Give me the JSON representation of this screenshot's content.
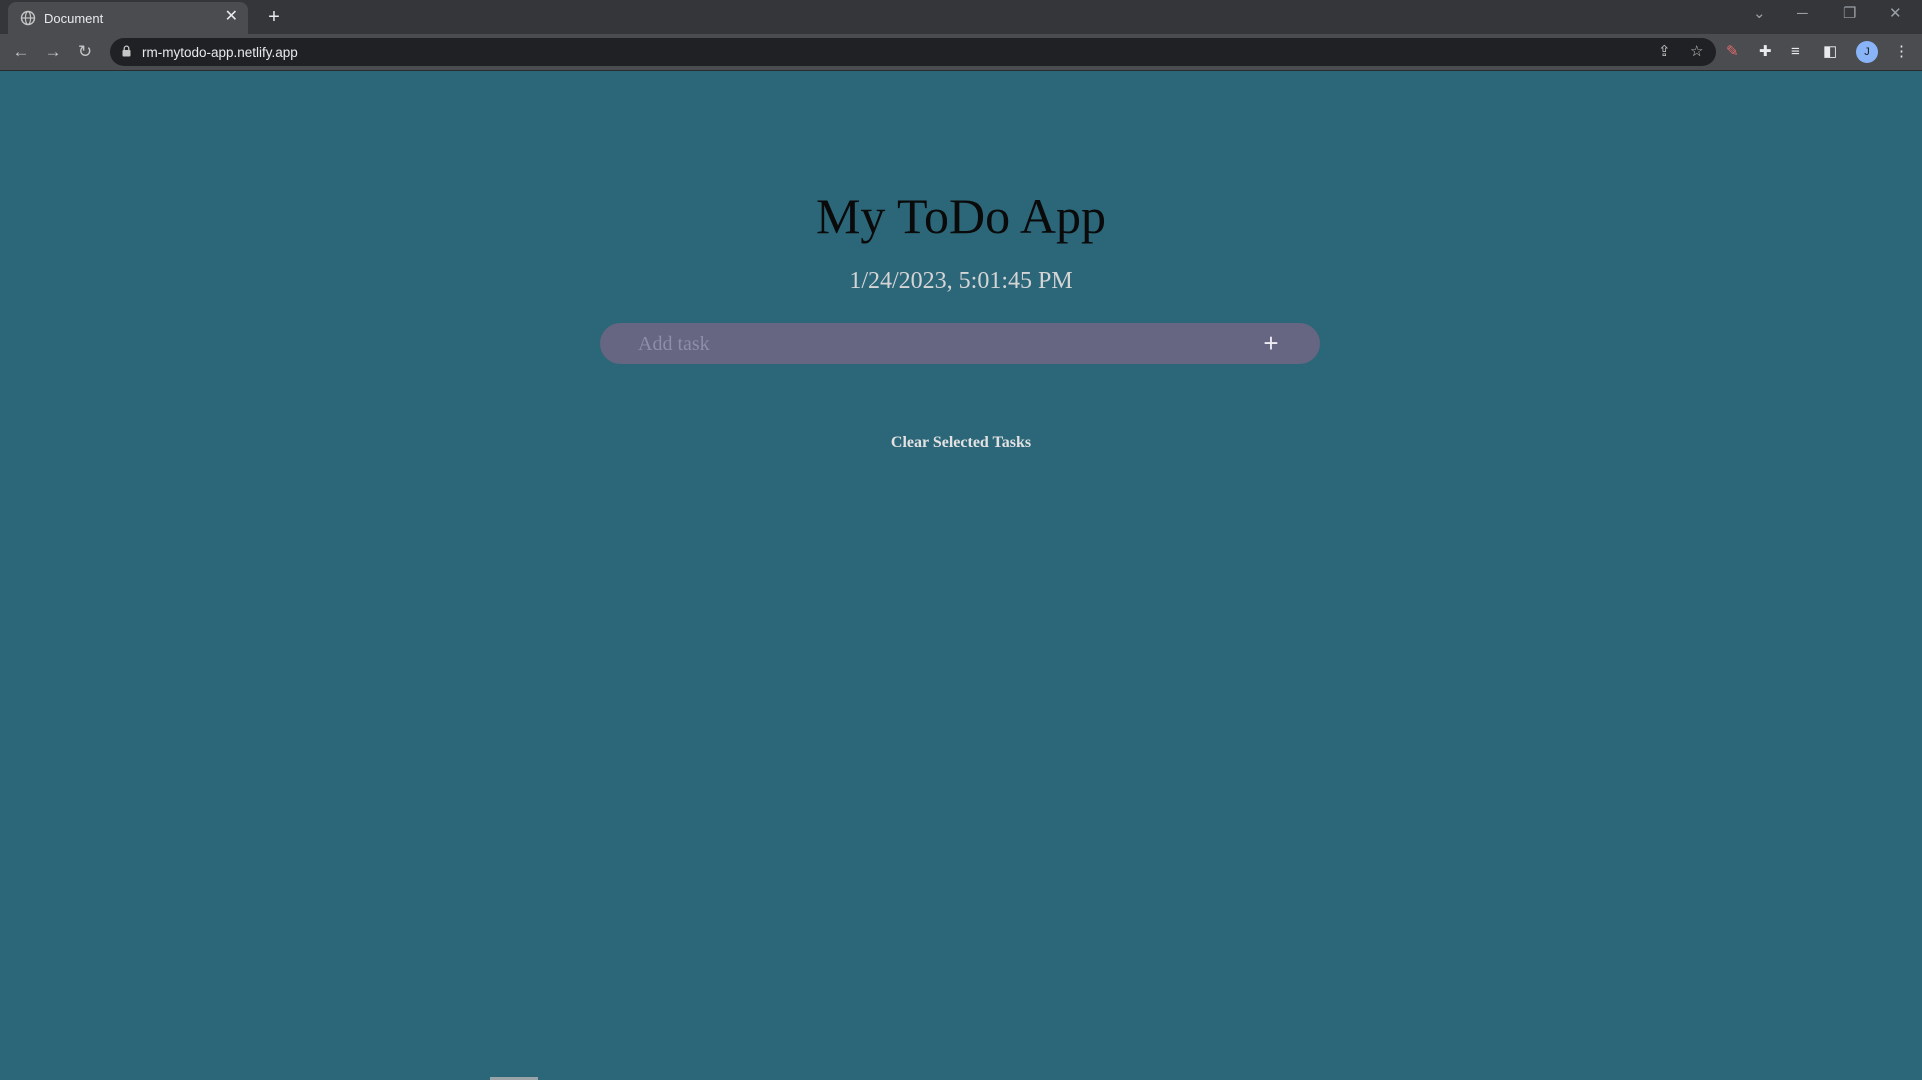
{
  "browser": {
    "tab": {
      "title": "Document",
      "close_glyph": "✕"
    },
    "new_tab_glyph": "+",
    "url": "rm-mytodo-app.netlify.app",
    "profile_initial": "J"
  },
  "app": {
    "title": "My ToDo App",
    "datetime": "1/24/2023, 5:01:45 PM",
    "task_input": {
      "placeholder": "Add task",
      "value": ""
    },
    "add_button_label": "+",
    "clear_button_label": "Clear Selected Tasks"
  },
  "colors": {
    "page_background": "#2c6679",
    "input_background": "#666582",
    "title_text": "#0a0a0a"
  }
}
